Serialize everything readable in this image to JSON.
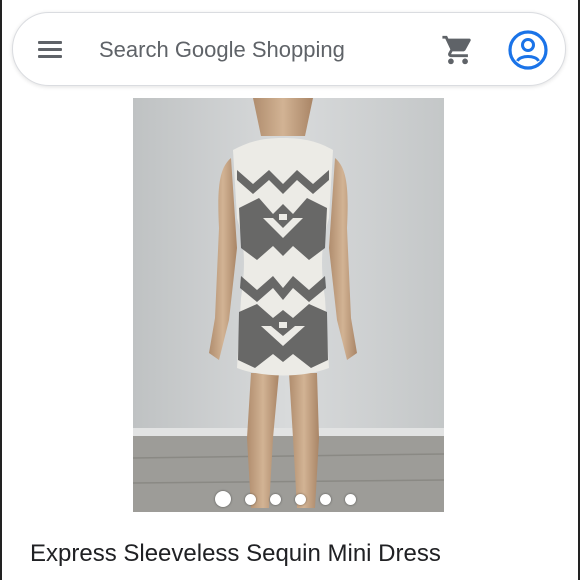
{
  "search": {
    "placeholder": "Search Google Shopping"
  },
  "icons": {
    "menu": "menu-icon",
    "cart": "shopping-cart-icon",
    "account": "account-circle-icon"
  },
  "colors": {
    "accent": "#1a73e8",
    "icon_gray": "#5f6368",
    "text": "#202124"
  },
  "carousel": {
    "image_count": 6,
    "active_index": 0
  },
  "product": {
    "title": "Express Sleeveless Sequin Mini Dress"
  }
}
